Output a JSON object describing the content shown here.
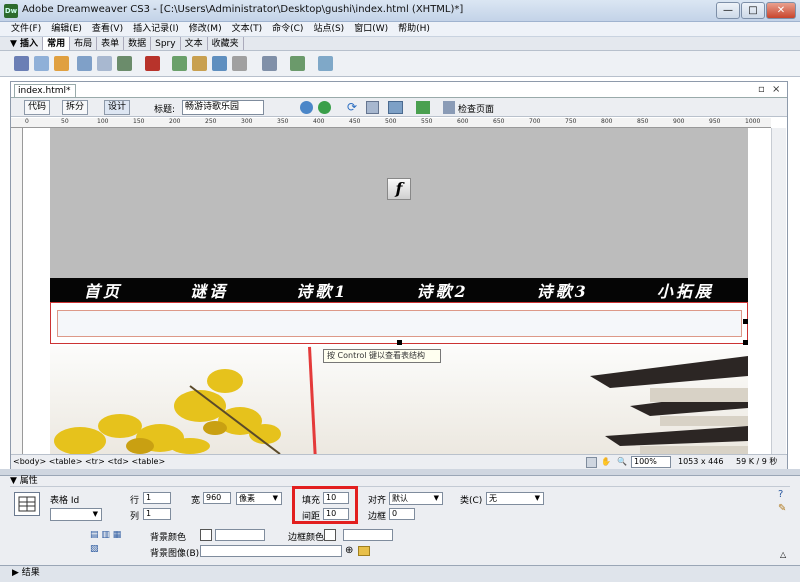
{
  "window": {
    "title": "Adobe Dreamweaver CS3 - [C:\\Users\\Administrator\\Desktop\\gushi\\index.html (XHTML)*]",
    "app_icon": "Dw",
    "minimize": "—",
    "maximize": "□",
    "close": "✕"
  },
  "menubar": [
    "文件(F)",
    "编辑(E)",
    "查看(V)",
    "插入记录(I)",
    "修改(M)",
    "文本(T)",
    "命令(C)",
    "站点(S)",
    "窗口(W)",
    "帮助(H)"
  ],
  "insertbar": {
    "label": "▼ 插入",
    "tabs": [
      "常用",
      "布局",
      "表单",
      "数据",
      "Spry",
      "文本",
      "收藏夹"
    ],
    "active": "常用"
  },
  "document": {
    "tab": "index.html*",
    "view_buttons": {
      "code": "代码",
      "split": "拆分",
      "design": "设计"
    },
    "title_label": "标题:",
    "title_value": "畅游诗歌乐园",
    "check_page": "检查页面"
  },
  "ruler_ticks": [
    "0",
    "50",
    "100",
    "150",
    "200",
    "250",
    "300",
    "350",
    "400",
    "450",
    "500",
    "550",
    "600",
    "650",
    "700",
    "750",
    "800",
    "850",
    "900",
    "950",
    "1000"
  ],
  "canvas": {
    "flash_glyph": "f",
    "nav_items": [
      "首页",
      "谜语",
      "诗歌1",
      "诗歌2",
      "诗歌3",
      "小拓展"
    ],
    "tooltip": "按 Control 键以查看表结构"
  },
  "statusbar": {
    "tag_selector": "<body> <table> <tr> <td> <table>",
    "zoom": "100%",
    "dimensions": "1053 x 446",
    "size": "59 K / 9 秒"
  },
  "properties": {
    "header": "▼ 属性",
    "table_label": "表格 Id",
    "rows_label": "行",
    "rows_value": "1",
    "cols_label": "列",
    "cols_value": "1",
    "width_label": "宽",
    "width_value": "960",
    "width_unit": "像素",
    "padding_label": "填充",
    "padding_value": "10",
    "spacing_label": "间距",
    "spacing_value": "10",
    "align_label": "对齐",
    "align_value": "默认",
    "class_label": "类(C)",
    "class_value": "无",
    "border_label": "边框",
    "border_value": "0",
    "bg_color_label": "背景颜色",
    "border_color_label": "边框颜色",
    "bg_image_label": "背景图像(B)"
  },
  "results_panel": "▶ 结果",
  "colors": {
    "highlight": "#e21f1f",
    "navbar": "#050505",
    "banner": "#bcbcbc"
  }
}
